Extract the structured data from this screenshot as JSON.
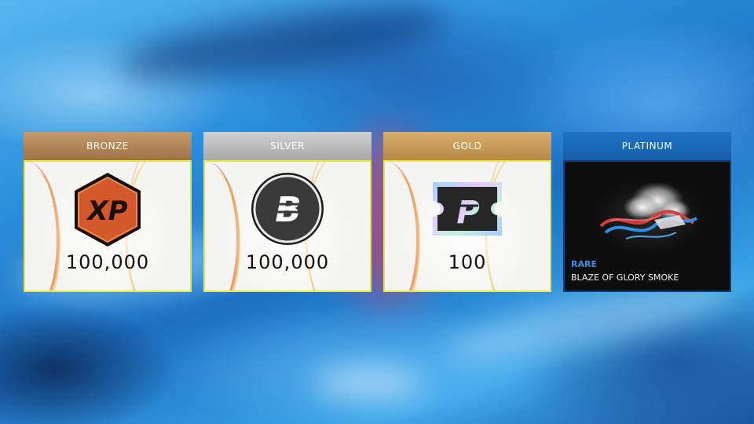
{
  "rewards": [
    {
      "tier": "BRONZE",
      "amount": "100,000",
      "icon": "xp-icon",
      "color": "#a07246"
    },
    {
      "tier": "SILVER",
      "amount": "100,000",
      "icon": "bucks-coin-icon",
      "color": "#a9a9a9"
    },
    {
      "tier": "GOLD",
      "amount": "100",
      "icon": "p-ticket-icon",
      "color": "#b98a46"
    },
    {
      "tier": "PLATINUM",
      "rarity": "RARE",
      "item_name": "BLAZE OF GLORY SMOKE",
      "icon": "smoke-item-icon",
      "color": "#165ea8"
    }
  ],
  "icon_labels": {
    "xp": "XP",
    "coin": "B",
    "ticket": "P"
  },
  "colors": {
    "highlight_border": "#e9e53a",
    "rarity_rare": "#3b8ee0"
  }
}
